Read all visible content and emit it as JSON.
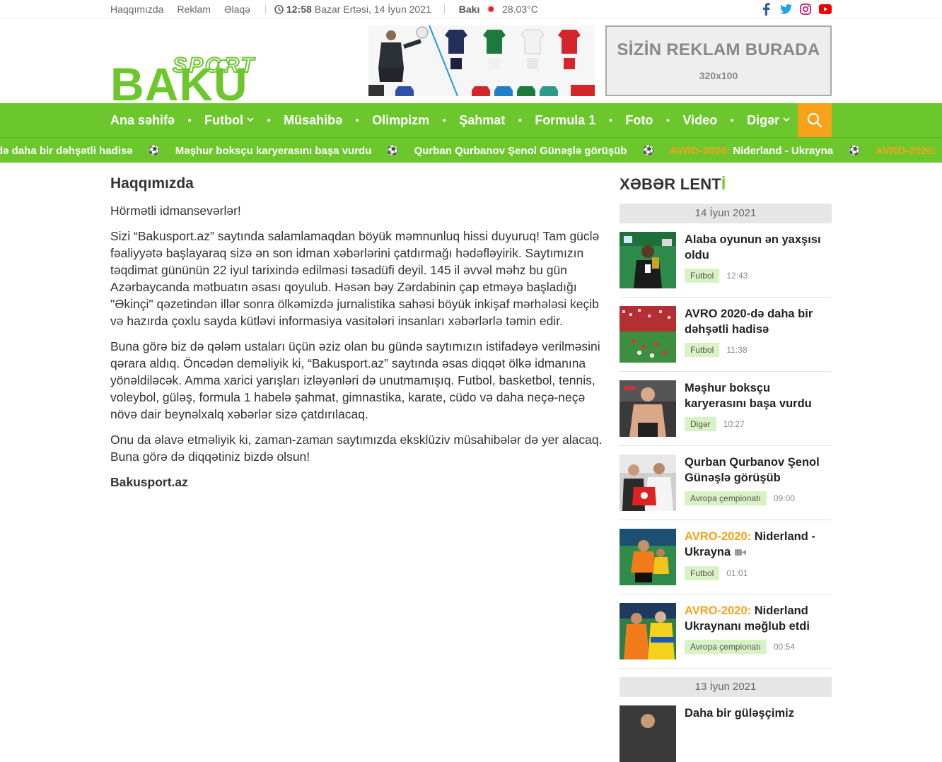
{
  "topbar": {
    "links": [
      "Haqqımızda",
      "Reklam",
      "Əlaqə"
    ],
    "time": "12:58",
    "date": "Bazar Ertəsi, 14 İyun 2021",
    "city": "Bakı",
    "temperature": "28.03°C",
    "socials": [
      "facebook-icon",
      "twitter-icon",
      "instagram-icon",
      "youtube-icon"
    ]
  },
  "logo": {
    "top": "SPORT",
    "main": "BAKU"
  },
  "ad": {
    "title": "SİZİN REKLAM BURADA",
    "size": "320x100"
  },
  "nav": {
    "items": [
      {
        "label": "Ana səhifə",
        "dropdown": false
      },
      {
        "label": "Futbol",
        "dropdown": true
      },
      {
        "label": "Müsahibə",
        "dropdown": false
      },
      {
        "label": "Olimpizm",
        "dropdown": false
      },
      {
        "label": "Şahmat",
        "dropdown": false
      },
      {
        "label": "Formula 1",
        "dropdown": false
      },
      {
        "label": "Foto",
        "dropdown": false
      },
      {
        "label": "Video",
        "dropdown": false
      },
      {
        "label": "Digər",
        "dropdown": true
      }
    ]
  },
  "ticker": {
    "items": [
      {
        "pre": "",
        "text": "-də daha bir dəhşətli hadisə"
      },
      {
        "pre": "",
        "text": "Məşhur boksçu karyerasını başa vurdu"
      },
      {
        "pre": "",
        "text": "Qurban Qurbanov Şenol Günəşlə görüşüb"
      },
      {
        "pre": "AVRO-2020:",
        "text": " Niderland - Ukrayna"
      },
      {
        "pre": "AVRO-2020:",
        "text": ""
      }
    ]
  },
  "article": {
    "title": "Haqqımızda",
    "paragraphs": [
      "Hörmətli idmansevərlər!",
      "Sizi “Bakusport.az” saytında salamlamaqdan böyük məmnunluq hissi duyuruq! Tam güclə fəaliyyətə başlayaraq sizə ən son idman xəbərlərini çatdırmağı hədəfləyirik. Saytımızın təqdimat gününün 22 iyul tarixində edilməsi təsadüfi deyil. 145 il əvvəl məhz bu gün Azərbaycanda mətbuatın əsası qoyulub. Həsən bəy Zərdabinin çap etməyə başladığı \"Əkinçi\" qəzetindən illər sonra ölkəmizdə jurnalistika sahəsi böyük inkişaf mərhələsi keçib və hazırda çoxlu sayda kütləvi informasiya vasitələri insanları xəbərlərlə təmin edir.",
      "Buna görə biz də qələm ustaları üçün əziz olan bu gündə saytımızın istifadəyə verilməsini qərara aldıq. Öncədən deməliyik ki, “Bakusport.az” saytında əsas diqqət ölkə idmanına yönəldiləcək. Amma xarici yarışları izləyənləri də unutmamışıq. Futbol, basketbol, tennis, voleybol, güləş, formula 1 habelə şahmat, gimnastika, karate, cüdo və daha neçə-neçə növə dair beynəlxalq xəbərlər sizə çatdırılacaq.",
      "Onu da əlavə etməliyik ki, zaman-zaman saytımızda eksklüziv müsahibələr də yer alacaq. Buna görə də diqqətiniz bizdə olsun!"
    ],
    "signature": "Bakusport.az"
  },
  "sidebar": {
    "heading_pre": "XƏBƏR LENT",
    "heading_accent": "İ",
    "date1": "14 İyun 2021",
    "date2": "13 İyun 2021",
    "news": [
      {
        "pre": "",
        "title": "Alaba oyunun ən yaxşısı oldu",
        "tag": "Futbol",
        "time": "12:43",
        "video": false
      },
      {
        "pre": "",
        "title": "AVRO 2020-də daha bir dəhşətli hadisə",
        "tag": "Futbol",
        "time": "11:38",
        "video": false
      },
      {
        "pre": "",
        "title": "Məşhur boksçu karyerasını başa vurdu",
        "tag": "Digər",
        "time": "10:27",
        "video": false
      },
      {
        "pre": "",
        "title": "Qurban Qurbanov Şenol Günəşlə görüşüb",
        "tag": "Avropa çempionatı",
        "time": "09:00",
        "video": false
      },
      {
        "pre": "AVRO-2020:",
        "title": " Niderland - Ukrayna",
        "tag": "Futbol",
        "time": "01:01",
        "video": true
      },
      {
        "pre": "AVRO-2020:",
        "title": " Niderland Ukraynanı məğlub etdi",
        "tag": "Avropa çempionatı",
        "time": "00:54",
        "video": false
      }
    ],
    "next_title": "Daha bir güləşçimiz"
  },
  "colors": {
    "green": "#6cc72d",
    "orange": "#f7a21a"
  }
}
